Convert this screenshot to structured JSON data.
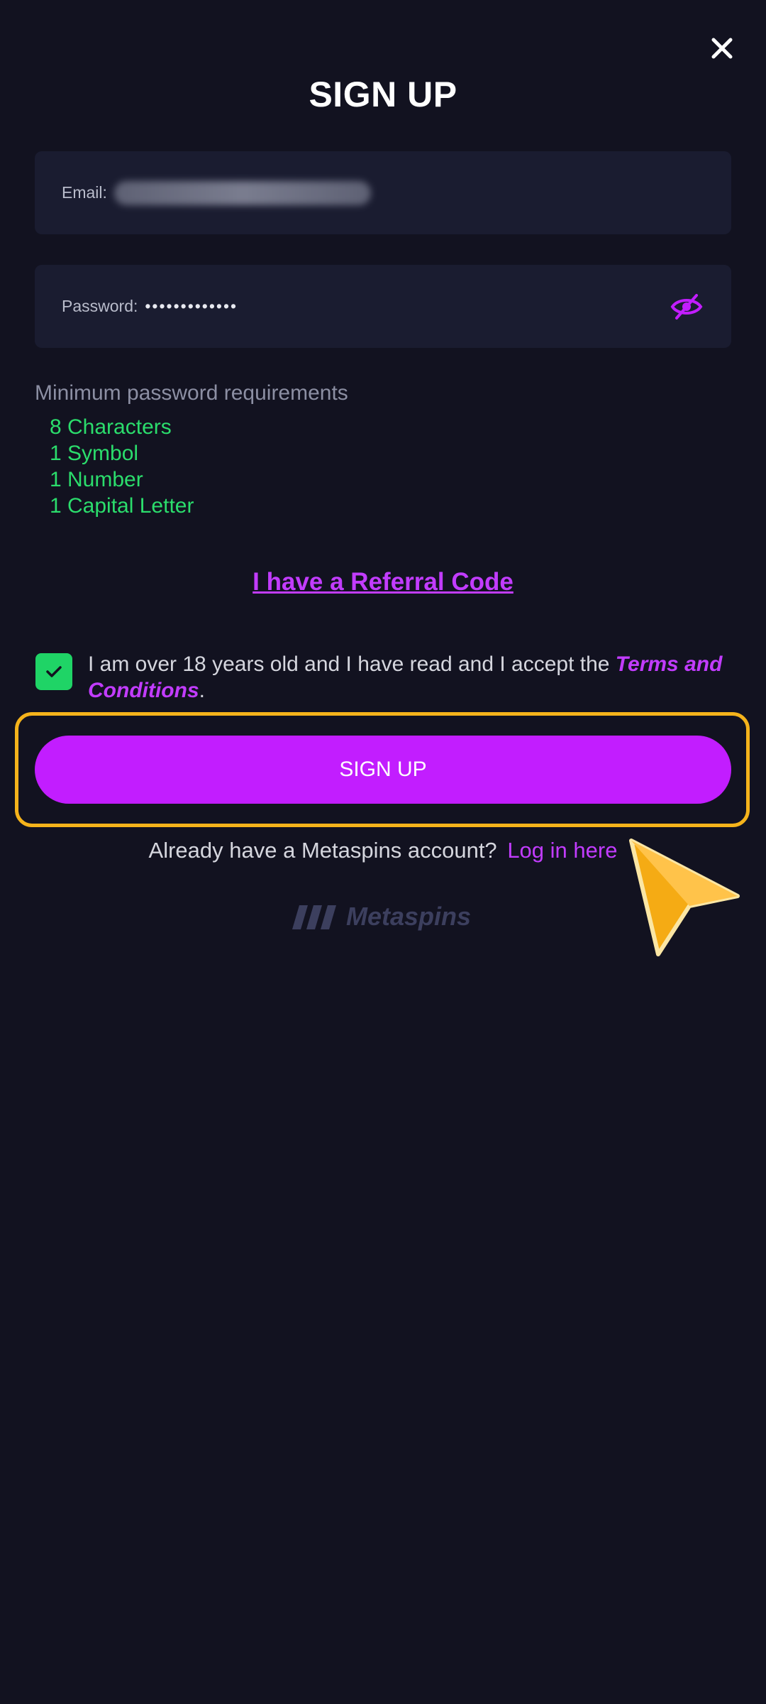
{
  "header": {
    "title": "SIGN UP",
    "close_icon": "close-icon"
  },
  "form": {
    "email_label": "Email:",
    "password_label": "Password:",
    "password_value": "•••••••••••••",
    "eye_icon": "eye-off-icon"
  },
  "requirements": {
    "title": "Minimum password requirements",
    "items": [
      "8 Characters",
      "1 Symbol",
      "1 Number",
      "1 Capital Letter"
    ]
  },
  "referral": {
    "link_text": "I have a Referral Code"
  },
  "consent": {
    "checked": true,
    "text": "I am over 18 years old and I have read and I accept the ",
    "link_text": "Terms and Conditions",
    "suffix": "."
  },
  "signup": {
    "button_label": "SIGN UP"
  },
  "login": {
    "prompt": "Already have a Metaspins account?",
    "link_text": "Log in here"
  },
  "brand": {
    "logo_text": "Metaspins"
  },
  "colors": {
    "background": "#121220",
    "field": "#1a1c30",
    "accent": "#c21dff",
    "success": "#2bdd6c",
    "highlight": "#f5b31b"
  }
}
